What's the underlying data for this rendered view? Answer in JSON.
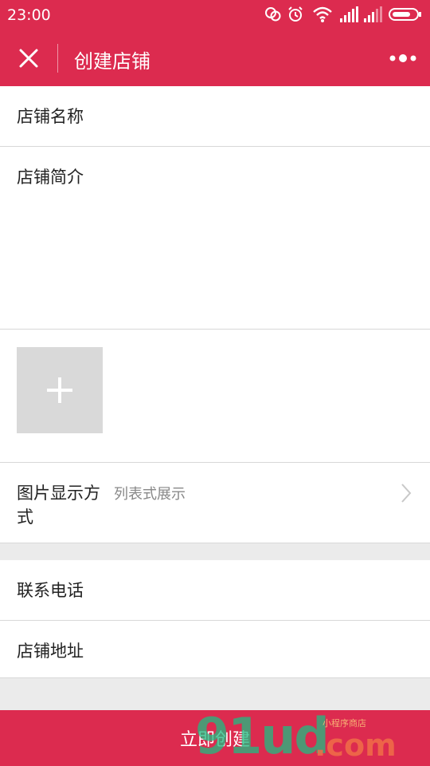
{
  "status": {
    "time": "23:00"
  },
  "nav": {
    "title": "创建店铺"
  },
  "form": {
    "name_label": "店铺名称",
    "intro_label": "店铺简介",
    "display_mode_label": "图片显示方式",
    "display_mode_value": "列表式展示",
    "phone_label": "联系电话",
    "address_label": "店铺地址"
  },
  "submit_label": "立即创建",
  "watermark": {
    "main": "91ud",
    "com": ".com",
    "small": "小程序商店"
  },
  "colors": {
    "brand": "#dc2b4f",
    "divider": "#d8d8d8",
    "background": "#ebebeb"
  },
  "icons": [
    "wechat-icon",
    "alarm-icon",
    "wifi-icon",
    "signal-icon",
    "battery-icon",
    "close-icon",
    "more-icon",
    "plus-icon",
    "chevron-right-icon"
  ]
}
